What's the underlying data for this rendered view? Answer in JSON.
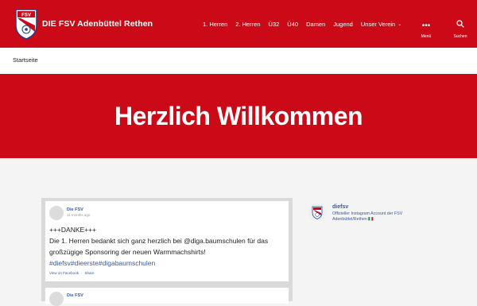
{
  "header": {
    "site_title": "DIE FSV Adenbüttel Rethen",
    "logo_text": "FSV",
    "nav": [
      "1. Herren",
      "2. Herren",
      "Ü32",
      "Ü40",
      "Damen",
      "Jugend",
      "Unser Verein"
    ],
    "menu_label": "Menü",
    "search_label": "Suchen"
  },
  "breadcrumb": "Startseite",
  "hero": {
    "title": "Herzlich Willkommen"
  },
  "facebook_post": {
    "author": "Die FSV",
    "time": "11 months ago",
    "lines": [
      "+++DANKE+++",
      "Die 1. Herren bedankt sich ganz herzlich bei @diga.baumschulen für das",
      "großzügige Sponsoring der neuen Warmmachshirts!",
      "#diefsv#dieerste#digabaumschulen"
    ],
    "view_on_facebook": "View on Facebook",
    "share": "Share"
  },
  "facebook_post_2": {
    "author": "Die FSV"
  },
  "instagram": {
    "username": "diefsv",
    "bio_line1": "Offizieller Instagram Account der FSV",
    "bio_line2": "Adenbüttel/Rethen 🇮🇹"
  },
  "colors": {
    "brand_red": "#cc0a17",
    "link_blue": "#3b5998"
  }
}
